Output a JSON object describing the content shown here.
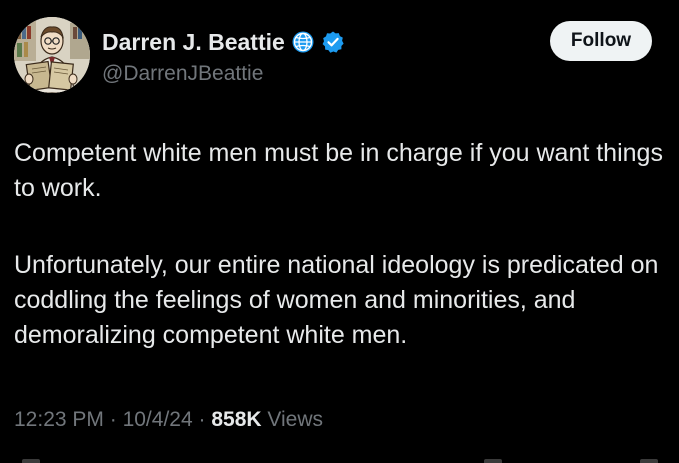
{
  "author": {
    "display_name": "Darren J. Beattie",
    "handle": "@DarrenJBeattie",
    "avatar_icon": "cartoon-reading-man-avatar",
    "affiliation_icon": "globe-icon",
    "verified_icon": "verified-badge-icon"
  },
  "actions": {
    "follow_label": "Follow"
  },
  "tweet": {
    "paragraph_1": "Competent white men must be in charge if you want things to work.",
    "paragraph_2": "Unfortunately, our entire national ideology is predicated on coddling the feelings of women and minorities, and demoralizing competent white men."
  },
  "meta": {
    "time": "12:23 PM",
    "date": "10/4/24",
    "separator": "·",
    "views_count": "858K",
    "views_label": "Views"
  },
  "colors": {
    "background": "#000000",
    "primary_text": "#e7e9ea",
    "secondary_text": "#71767b",
    "verified_blue": "#1d9bf0",
    "follow_bg": "#eff3f4"
  }
}
